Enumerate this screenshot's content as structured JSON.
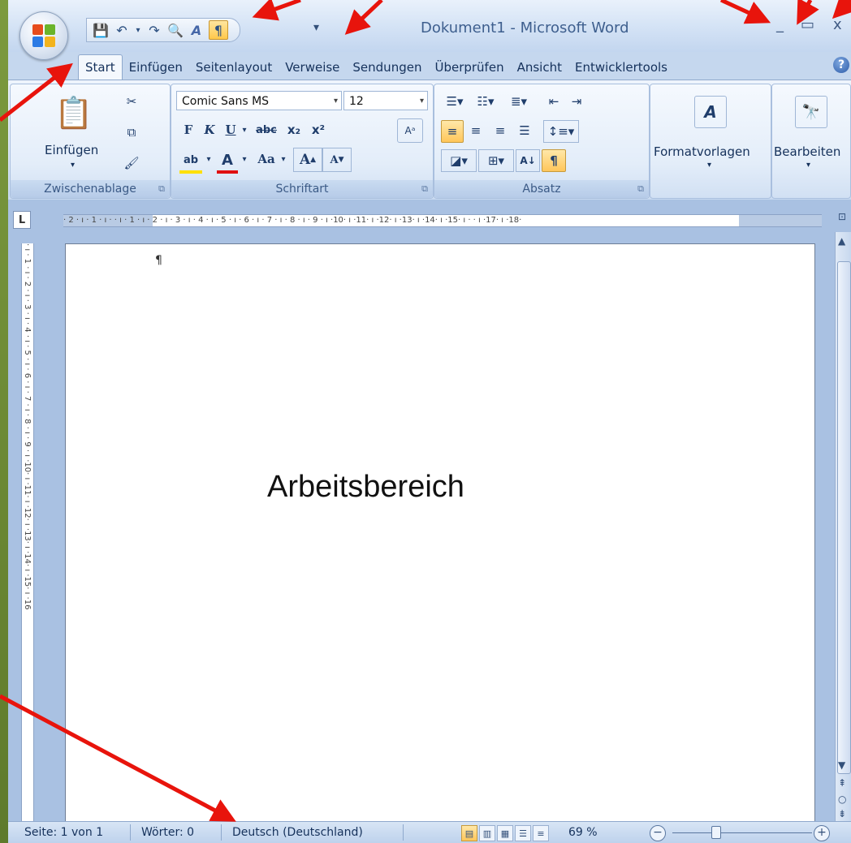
{
  "window": {
    "title": "Dokument1 - Microsoft Word",
    "controls": {
      "minimize": "_",
      "maximize": "▭",
      "close": "x"
    }
  },
  "quick_access": {
    "more": "▾"
  },
  "tabs": [
    "Start",
    "Einfügen",
    "Seitenlayout",
    "Verweise",
    "Sendungen",
    "Überprüfen",
    "Ansicht",
    "Entwicklertools"
  ],
  "active_tab": "Start",
  "ribbon": {
    "clipboard": {
      "caption": "Zwischenablage",
      "paste_label": "Einfügen"
    },
    "font": {
      "caption": "Schriftart",
      "font_name": "Comic Sans MS",
      "font_size": "12",
      "bold": "F",
      "italic": "K",
      "underline": "U",
      "strike": "abc",
      "sub": "x₂",
      "sup": "x²",
      "case": "Aa",
      "grow": "A",
      "shrink": "A"
    },
    "paragraph": {
      "caption": "Absatz",
      "pilcrow": "¶",
      "sort": "A↓"
    },
    "styles": {
      "label": "Formatvorlagen"
    },
    "editing": {
      "label": "Bearbeiten"
    }
  },
  "ruler": {
    "horizontal": "· 2 · ı · 1 · ı ·   · ı · 1 · ı · 2 · ı · 3 · ı · 4 · ı · 5 · ı · 6 · ı · 7 · ı · 8 · ı · 9 · ı ·10· ı ·11· ı ·12· ı ·13· ı ·14· ı ·15· ı ·   · ı ·17· ı ·18·",
    "vertical": "· ı · 1 · ı · 2 · ı · 3 · ı · 4 · ı · 5 · ı · 6 · ı · 7 · ı · 8 · ı · 9 · ı ·10· ı ·11· ı ·12· ı ·13· ı ·14· ı ·15· ı ·16",
    "tab_selector": "L"
  },
  "document": {
    "pilcrow": "¶",
    "workspace_label": "Arbeitsbereich"
  },
  "status": {
    "page": "Seite: 1 von 1",
    "words": "Wörter: 0",
    "language": "Deutsch (Deutschland)",
    "zoom": "69 %",
    "zoom_minus": "−",
    "zoom_plus": "+"
  },
  "colors": {
    "frame": "#6f8a3a",
    "arrow": "#e8140c",
    "ribbon": "#dbe7f6",
    "highlight": "#ffc65a"
  }
}
